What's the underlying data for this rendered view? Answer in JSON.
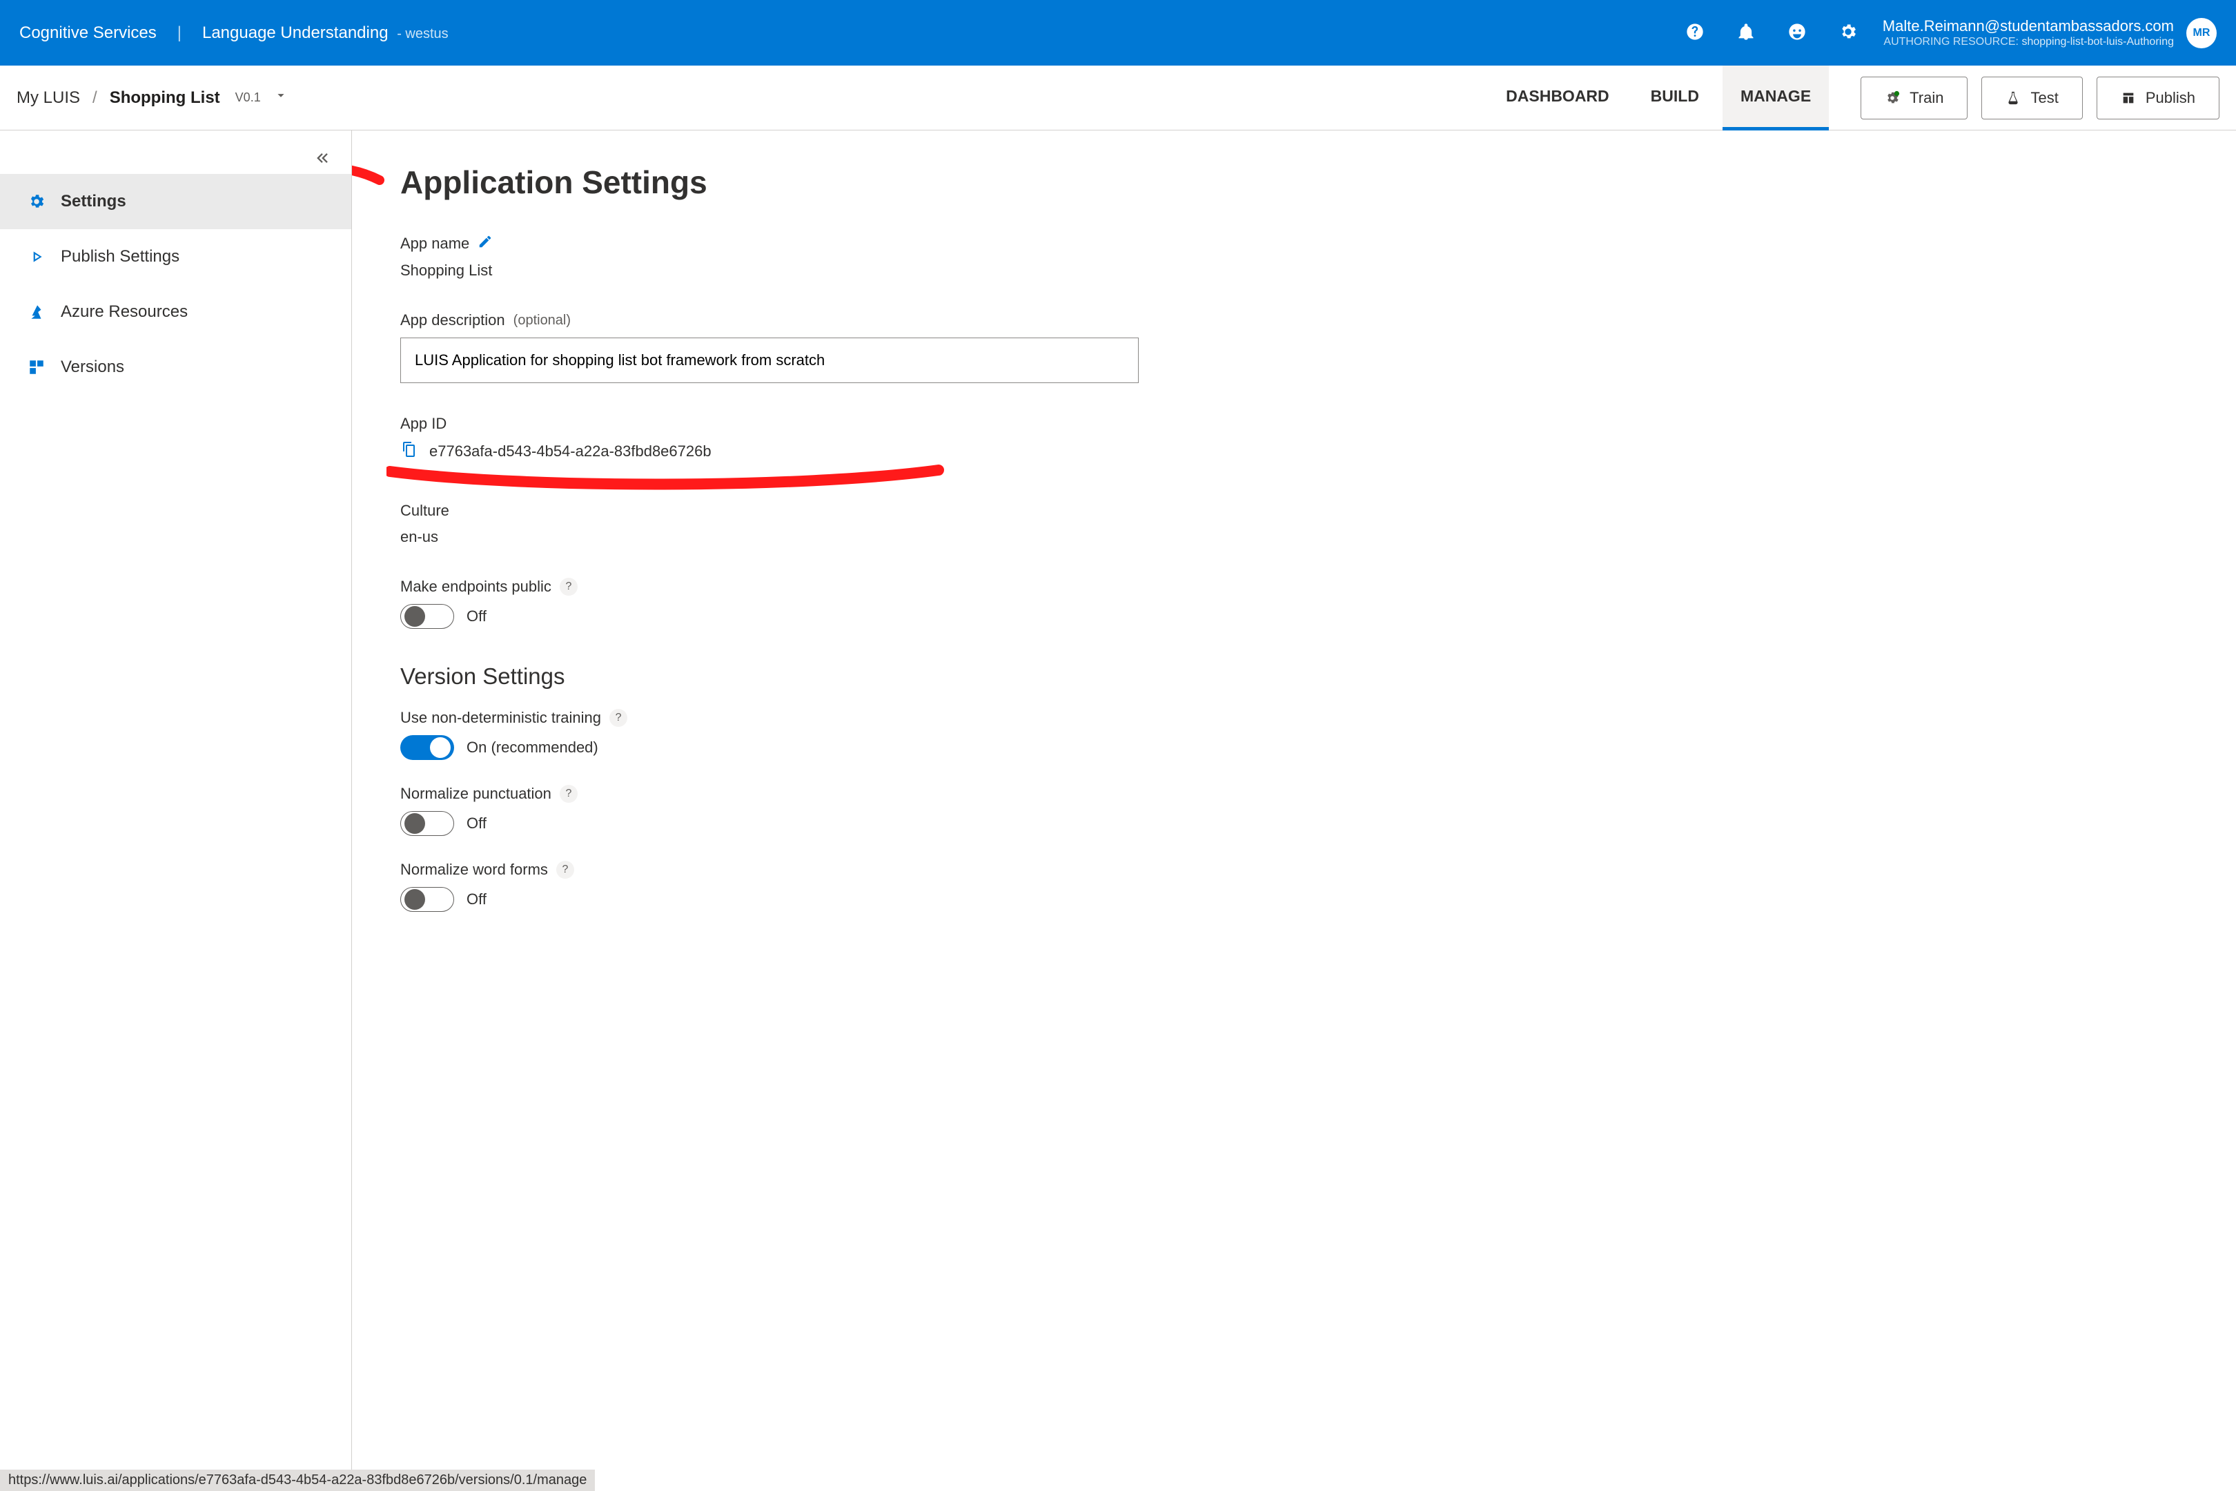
{
  "header": {
    "service": "Cognitive Services",
    "subservice": "Language Understanding",
    "region": "- westus",
    "user_email": "Malte.Reimann@studentambassadors.com",
    "resource_label": "AUTHORING RESOURCE:",
    "resource_value": "shopping-list-bot-luis-Authoring",
    "avatar_initials": "MR"
  },
  "breadcrumb": {
    "root": "My LUIS",
    "current": "Shopping List",
    "version": "V0.1"
  },
  "nav_tabs": {
    "dashboard": "DASHBOARD",
    "build": "BUILD",
    "manage": "MANAGE"
  },
  "actions": {
    "train": "Train",
    "test": "Test",
    "publish": "Publish"
  },
  "sidebar": {
    "items": [
      {
        "label": "Settings"
      },
      {
        "label": "Publish Settings"
      },
      {
        "label": "Azure Resources"
      },
      {
        "label": "Versions"
      }
    ]
  },
  "page": {
    "title": "Application Settings",
    "app_name_label": "App name",
    "app_name_value": "Shopping List",
    "app_desc_label": "App description",
    "optional": "(optional)",
    "app_desc_value": "LUIS Application for shopping list bot framework from scratch",
    "app_id_label": "App ID",
    "app_id_value": "e7763afa-d543-4b54-a22a-83fbd8e6726b",
    "culture_label": "Culture",
    "culture_value": "en-us",
    "endpoints_label": "Make endpoints public",
    "off": "Off",
    "on_rec": "On (recommended)",
    "version_settings_title": "Version Settings",
    "nondet_label": "Use non-deterministic training",
    "norm_punct_label": "Normalize punctuation",
    "norm_word_label": "Normalize word forms",
    "help": "?"
  },
  "status_url": "https://www.luis.ai/applications/e7763afa-d543-4b54-a22a-83fbd8e6726b/versions/0.1/manage"
}
